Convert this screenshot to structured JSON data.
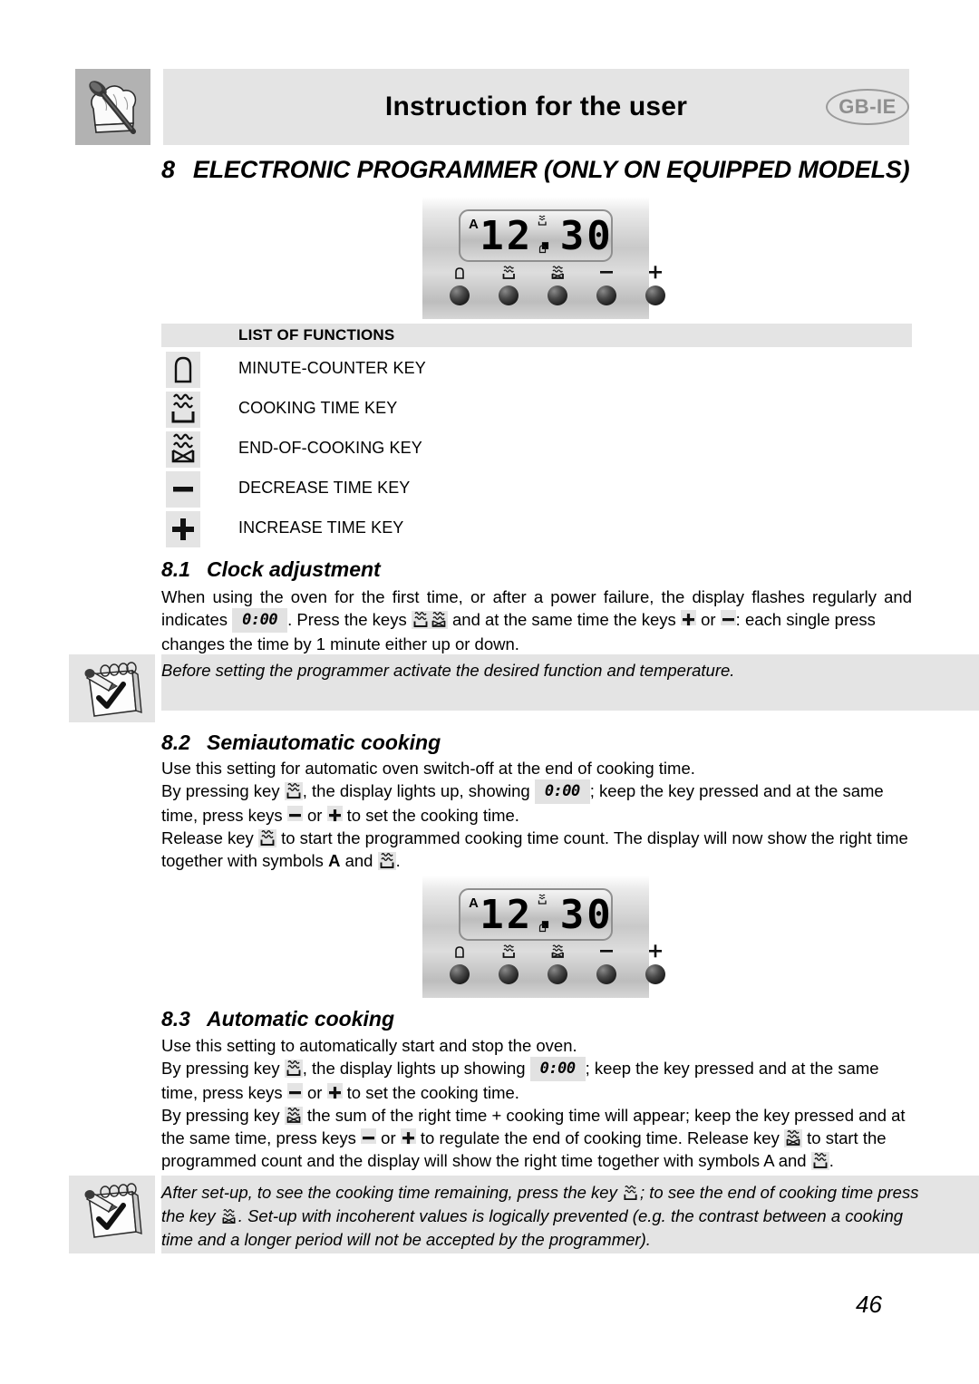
{
  "header": {
    "title": "Instruction for the user",
    "language_badge": "GB-IE",
    "chef_icon": "chef-hat-spoon-icon"
  },
  "chapter": {
    "number": "8",
    "title": "ELECTRONIC PROGRAMMER (ONLY ON EQUIPPED MODELS)"
  },
  "programmer_display": {
    "annunciator": "A",
    "time": "12.30",
    "mini_top_symbol": "cooking-time-symbol",
    "mini_bottom_symbol": "minute-counter-symbol",
    "keys": [
      {
        "name": "minute-counter-key",
        "glyph": "bell"
      },
      {
        "name": "cooking-time-key",
        "glyph": "pot"
      },
      {
        "name": "end-of-cooking-key",
        "glyph": "pot-crossed"
      },
      {
        "name": "decrease-time-key",
        "glyph": "minus"
      },
      {
        "name": "increase-time-key",
        "glyph": "plus"
      }
    ]
  },
  "functions_table": {
    "heading": "LIST OF FUNCTIONS",
    "rows": [
      {
        "icon": "bell-icon",
        "label": "MINUTE-COUNTER KEY"
      },
      {
        "icon": "pot-heat-icon",
        "label": "COOKING TIME KEY"
      },
      {
        "icon": "pot-crossed-icon",
        "label": "END-OF-COOKING KEY"
      },
      {
        "icon": "minus-icon",
        "label": "DECREASE TIME KEY"
      },
      {
        "icon": "plus-icon",
        "label": "INCREASE TIME KEY"
      }
    ]
  },
  "section_8_1": {
    "number": "8.1",
    "title": "Clock adjustment",
    "line1": "When using the oven for the first time, or after a power failure, the display flashes regularly and",
    "line2_a": "indicates",
    "line2_value": "0:00",
    "line2_b": ". Press the keys",
    "line2_c": "and at the same time the keys",
    "line2_d": "or",
    "line2_e": ": each single press",
    "line3": "changes the time by 1 minute either up or down."
  },
  "note_1": {
    "text": "Before setting the programmer activate the desired function and temperature.",
    "icon": "notepad-pencil-check-icon"
  },
  "section_8_2": {
    "number": "8.2",
    "title": "Semiautomatic cooking",
    "line1": "Use this setting for automatic oven switch-off at the end of cooking time.",
    "line2_a": "By pressing key",
    "line2_b": ", the display lights up, showing",
    "line2_value": "0:00",
    "line2_c": "; keep the key pressed and at the same",
    "line3_a": "time, press keys",
    "line3_b": "or",
    "line3_c": "to set the cooking time.",
    "line4_a": "Release key",
    "line4_b": "to start the programmed cooking time count. The display will now show the right time",
    "line5_a": "together with symbols",
    "line5_symbol": "A",
    "line5_b": "and",
    "line5_c": "."
  },
  "section_8_3": {
    "number": "8.3",
    "title": "Automatic cooking",
    "line1": "Use this setting to automatically start and stop the oven.",
    "line2_a": "By pressing key",
    "line2_b": ", the display lights up showing",
    "line2_value": "0:00",
    "line2_c": "; keep the key pressed and at the same",
    "line3_a": "time, press keys",
    "line3_b": "or",
    "line3_c": "to set the cooking time.",
    "line4_a": "By pressing key",
    "line4_b": "the sum of the right time + cooking time will appear; keep the key pressed and at",
    "line5_a": "the same time, press keys",
    "line5_b": "or",
    "line5_c": "to regulate the end of cooking time. Release key",
    "line5_d": "to start the",
    "line6_a": "programmed count and the display will show the right time together with symbols A and",
    "line6_b": "."
  },
  "note_2": {
    "icon": "notepad-pencil-check-icon",
    "line1_a": "After set-up, to see the cooking time remaining, press the key",
    "line1_b": "; to see the end of cooking time press",
    "line2_a": "the key",
    "line2_b": ". Set-up with incoherent values is logically prevented (e.g. the contrast between a cooking",
    "line3": "time and a longer period will not be accepted by the programmer)."
  },
  "page_number": "46",
  "colors": {
    "band_gray": "#e4e4e4",
    "icon_box_gray": "#b2b2b2",
    "badge_gray": "#8e8e8e"
  }
}
